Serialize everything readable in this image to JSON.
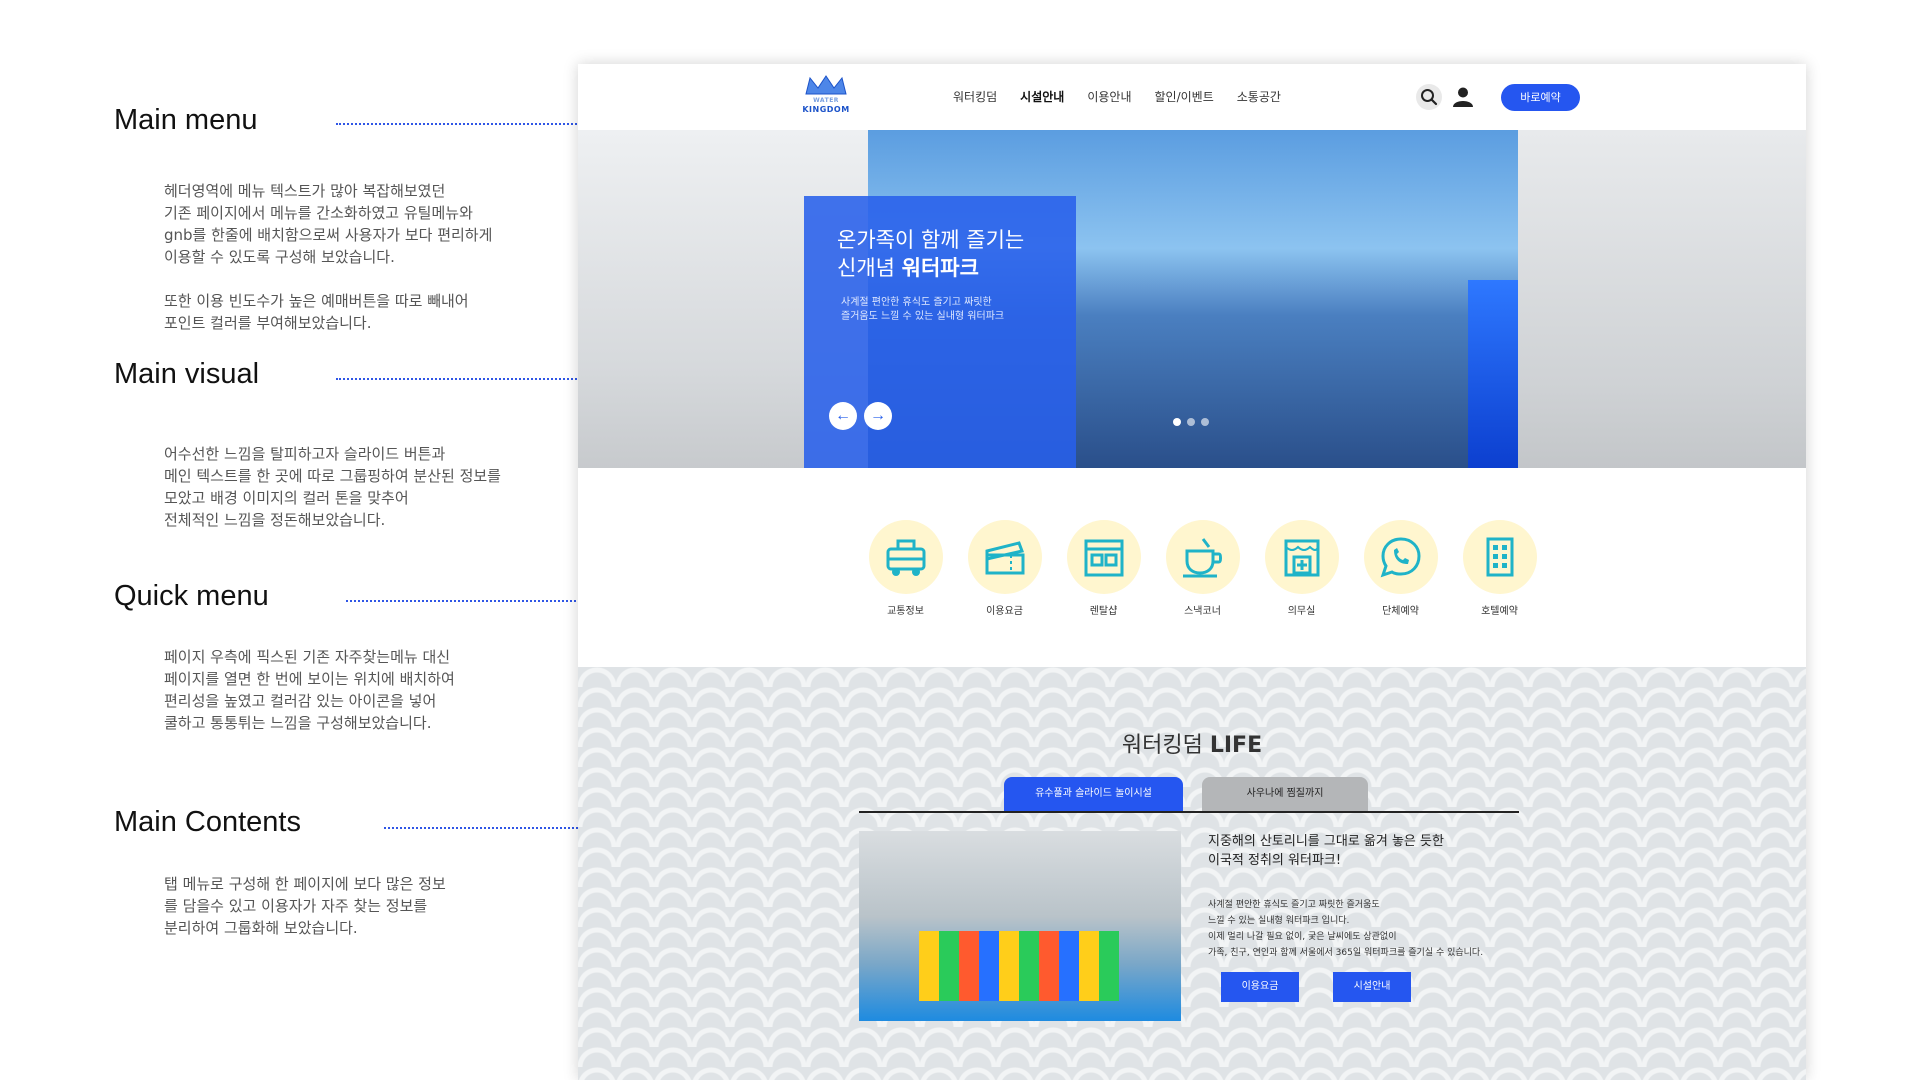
{
  "annotations": {
    "main_menu": {
      "title": "Main menu",
      "desc": "헤더영역에 메뉴 텍스트가 많아 복잡해보였던\n기존 페이지에서 메뉴를 간소화하였고 유틸메뉴와\ngnb를 한줄에 배치함으로써 사용자가 보다 편리하게\n이용할 수 있도록 구성해 보았습니다.\n\n또한 이용 빈도수가 높은 예매버튼을 따로 빼내어\n포인트 컬러를 부여해보았습니다."
    },
    "main_visual": {
      "title": "Main visual",
      "desc": "어수선한 느낌을 탈피하고자 슬라이드 버튼과\n메인 텍스트를  한 곳에 따로 그룹핑하여 분산된 정보를\n모았고 배경 이미지의 컬러 톤을 맞추어\n전체적인 느낌을 정돈해보았습니다."
    },
    "quick_menu": {
      "title": "Quick menu",
      "desc": "페이지 우측에 픽스된 기존 자주찾는메뉴 대신\n페이지를 열면 한 번에 보이는 위치에 배치하여\n편리성을 높였고 컬러감 있는 아이콘을 넣어\n쿨하고 통통튀는 느낌을 구성해보았습니다."
    },
    "main_contents": {
      "title": "Main Contents",
      "desc": "탭 메뉴로 구성해 한 페이지에 보다 많은 정보\n를 담을수 있고 이용자가 자주 찾는 정보를\n분리하여 그룹화해 보았습니다."
    }
  },
  "header": {
    "logo_small": "WATER",
    "logo_text": "KINGDOM",
    "gnb": [
      "워터킹덤",
      "시설안내",
      "이용안내",
      "할인/이벤트",
      "소통공간"
    ],
    "active_index": 1,
    "book_label": "바로예약"
  },
  "visual": {
    "heading_line1": "온가족이 함께 즐기는",
    "heading_line2_prefix": "신개념 ",
    "heading_line2_bold": "워터파크",
    "sub": "사계절 편안한 휴식도 즐기고 짜릿한\n즐거움도 느낄 수 있는 실내형 워터파크",
    "slides": 3,
    "active_slide": 0
  },
  "quick_menu": [
    {
      "label": "교통정보",
      "icon": "bus-icon"
    },
    {
      "label": "이용요금",
      "icon": "ticket-icon"
    },
    {
      "label": "렌탈샵",
      "icon": "shop-icon"
    },
    {
      "label": "스낵코너",
      "icon": "coffee-cup-icon"
    },
    {
      "label": "의무실",
      "icon": "medical-icon"
    },
    {
      "label": "단체예약",
      "icon": "whatsapp-icon"
    },
    {
      "label": "호텔예약",
      "icon": "hotel-icon"
    }
  ],
  "life": {
    "title_prefix": "워터킹덤 ",
    "title_bold": "LIFE",
    "tabs": [
      "유수풀과 슬라이드 놀이시설",
      "사우나에 찜질까지"
    ],
    "active_tab": 0,
    "heading": "지중해의 산토리니를 그대로 옮겨 놓은 듯한\n이국적 정취의 워터파크!",
    "body": "사계절 편안한 휴식도 즐기고 짜릿한 즐거움도\n느낄 수 있는 실내형 워터파크 입니다.\n이제 멀리 나갈 필요 없이, 궂은 날씨에도 상관없이\n가족, 친구, 연인과 함께 서울에서 365일 워터파크를 즐기실 수 있습니다.",
    "buttons": [
      "이용요금",
      "시설안내"
    ]
  },
  "colors": {
    "accent": "#2556f0",
    "icon_bg": "#fff6cf",
    "icon_fg": "#1fb3c8"
  }
}
